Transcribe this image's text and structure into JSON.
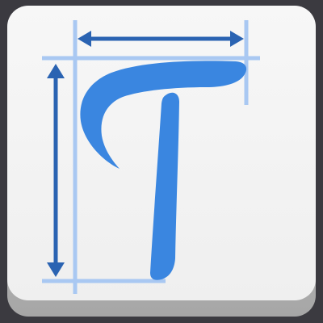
{
  "app_icon": {
    "name": "font-measurement-app-icon",
    "glyph": "T",
    "colors": {
      "background": "#3b3a40",
      "tile_face": "#f4f4f4",
      "tile_edge": "#bdbdbd",
      "glyph": "#3a86e0",
      "guide_lines": "#a9c8f2",
      "arrows": "#2a63b2"
    }
  }
}
